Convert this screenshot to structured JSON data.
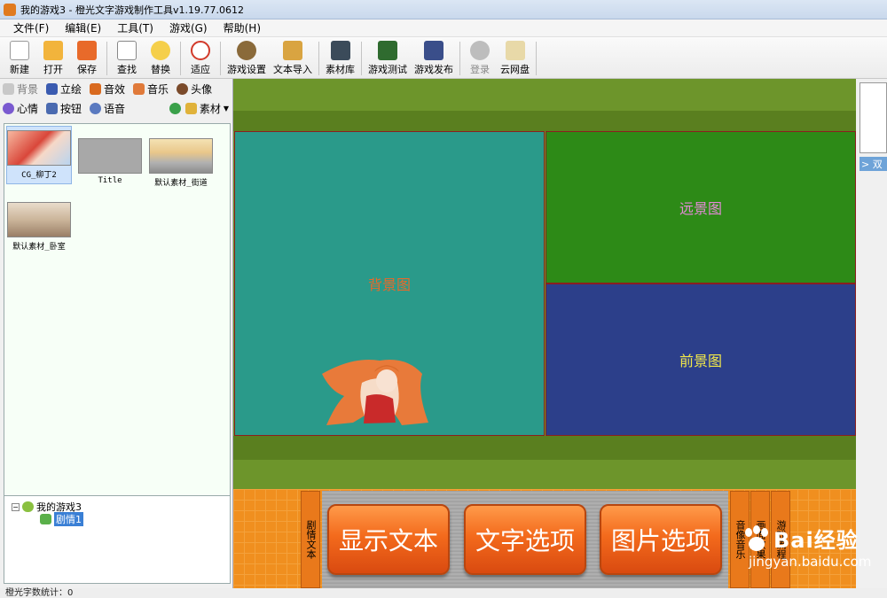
{
  "window": {
    "title": "我的游戏3 - 橙光文字游戏制作工具v1.19.77.0612"
  },
  "menu": [
    "文件(F)",
    "编辑(E)",
    "工具(T)",
    "游戏(G)",
    "帮助(H)"
  ],
  "toolbar": [
    {
      "label": "新建",
      "icon": "new-file-icon"
    },
    {
      "label": "打开",
      "icon": "open-folder-icon"
    },
    {
      "label": "保存",
      "icon": "save-icon"
    },
    {
      "label": "查找",
      "icon": "find-icon"
    },
    {
      "label": "替换",
      "icon": "replace-icon"
    },
    {
      "label": "适应",
      "icon": "fit-icon"
    },
    {
      "label": "游戏设置",
      "icon": "game-settings-icon"
    },
    {
      "label": "文本导入",
      "icon": "text-import-icon"
    },
    {
      "label": "素材库",
      "icon": "asset-library-icon"
    },
    {
      "label": "游戏测试",
      "icon": "game-test-icon"
    },
    {
      "label": "游戏发布",
      "icon": "game-publish-icon"
    },
    {
      "label": "登录",
      "icon": "login-icon"
    },
    {
      "label": "云网盘",
      "icon": "cloud-drive-icon"
    }
  ],
  "categories_row1": [
    "背景",
    "立绘",
    "音效",
    "音乐",
    "头像"
  ],
  "categories_row2": [
    "心情",
    "按钮",
    "语音"
  ],
  "assets_dropdown": "素材",
  "assets": [
    {
      "label": "CG_柳丁2"
    },
    {
      "label": "Title"
    },
    {
      "label": "默认素材_街道"
    },
    {
      "label": "默认素材_卧室"
    }
  ],
  "tree": {
    "root": "我的游戏3",
    "child": "剧情1"
  },
  "status": "橙光字数统计：0",
  "stage": {
    "background_label": "背景图",
    "far_label": "远景图",
    "fore_label": "前景图",
    "story_tab": "剧情文本",
    "buttons": [
      "显示文本",
      "文字选项",
      "图片选项"
    ],
    "music_tab": "音像音乐",
    "effect_tab": "画面效果",
    "flow_tab": "游戏流程"
  },
  "right_panel": {
    "tab": "> 双"
  },
  "watermark": {
    "brand": "Bai经验",
    "url": "jingyan.baidu.com"
  }
}
